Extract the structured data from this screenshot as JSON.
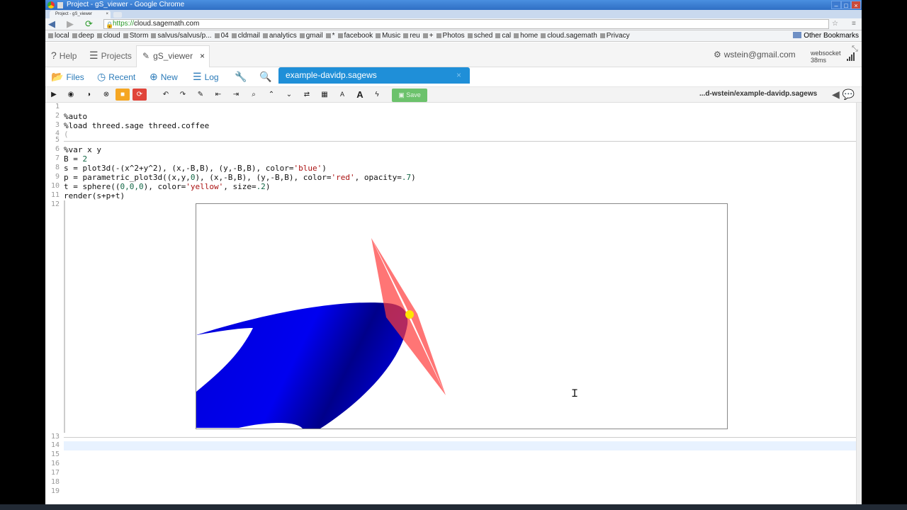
{
  "window": {
    "title": "Project - gS_viewer - Google Chrome",
    "tab_label": "Project - gS_viewer",
    "tab_close": "×",
    "minimize": "–",
    "maximize": "□",
    "close": "×"
  },
  "address": {
    "scheme": "https://",
    "host": "cloud.sagemath.com",
    "menu": "≡"
  },
  "bookmarks": [
    "local",
    "deep",
    "cloud",
    "Storm",
    "salvus/salvus/p...",
    "04",
    "cldmail",
    "analytics",
    "gmail",
    "*",
    "facebook",
    "Music",
    "reu",
    "+",
    "Photos",
    "sched",
    "cal",
    "home",
    "cloud.sagemath",
    "Privacy"
  ],
  "bookmarks_other": "Other Bookmarks",
  "top_tabs": {
    "help": "Help",
    "projects": "Projects",
    "file_tab": "gS_viewer",
    "file_tab_close": "×"
  },
  "user": {
    "email": "wstein@gmail.com",
    "websocket_label": "websocket",
    "latency": "38ms"
  },
  "files_bar": {
    "files": "Files",
    "recent": "Recent",
    "new": "New",
    "log": "Log",
    "open_file": "example-davidp.sagews",
    "open_file_close": "×"
  },
  "toolbar": {
    "save": "Save",
    "path": "...d-wstein/example-davidp.sagews"
  },
  "editor": {
    "line_numbers": [
      "1",
      "2",
      "3",
      "4",
      "5",
      "6",
      "7",
      "8",
      "9",
      "10",
      "11",
      "12",
      "13",
      "14",
      "15",
      "16",
      "17",
      "18",
      "19"
    ],
    "lines": {
      "l2": "%auto",
      "l3": "%load threed.sage threed.coffee",
      "l4": "(",
      "l6": "%var x y",
      "l7a": "B = ",
      "l7b": "2",
      "l8a": "s = plot3d(-(x^2+y^2), (x,-B,B), (y,-B,B), color=",
      "l8b": "'blue'",
      "l8c": ")",
      "l9a": "p = parametric_plot3d((x,y,",
      "l9b": "0",
      "l9c": "), (x,-B,B), (y,-B,B), color=",
      "l9d": "'red'",
      "l9e": ", opacity=",
      "l9f": ".7",
      "l9g": ")",
      "l10a": "t = sphere((",
      "l10b": "0,0,0",
      "l10c": "), color=",
      "l10d": "'yellow'",
      "l10e": ", size=",
      "l10f": ".2",
      "l10g": ")",
      "l11": "render(s+p+t)"
    }
  },
  "render_scene": {
    "surface_color": "#0000e6",
    "plane_color": "#ff3b3b",
    "plane_opacity": 0.7,
    "sphere_color": "#ffe600"
  }
}
